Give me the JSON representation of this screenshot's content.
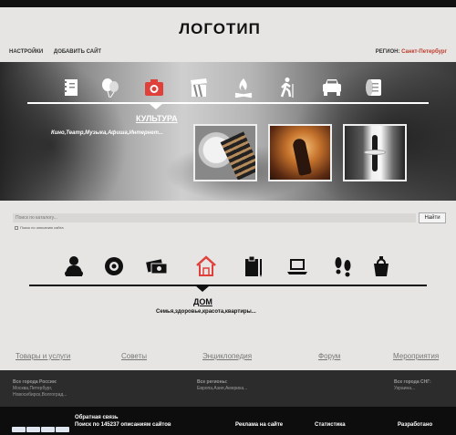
{
  "header": {
    "logo": "ЛОГОТИП",
    "nav": [
      "НАСТРОЙКИ",
      "ДОБАВИТЬ САЙТ"
    ],
    "region_label": "РЕГИОН:",
    "region_value": "Санкт-Петербург"
  },
  "culture_section": {
    "title": "КУЛЬТУРА",
    "subtitle": "Кино,Театр,Музыка,Афиша,Интернет...",
    "icons": [
      "notebook-icon",
      "balloons-icon",
      "camera-icon",
      "cinema-clapper-icon",
      "campfire-icon",
      "hiker-icon",
      "car-icon",
      "scroll-icon"
    ],
    "active_icon_color": "#e0403a"
  },
  "search": {
    "placeholder": "Поиск по каталогу...",
    "button_label": "Найти",
    "checkbox_label": "Поиск по описанию сайта"
  },
  "home_section": {
    "title": "ДОМ",
    "subtitle": "Семья,здоровье,красота,квартиры...",
    "icons": [
      "baby-icon",
      "disc-icon",
      "money-icon",
      "house-icon",
      "clipboard-icon",
      "laptop-icon",
      "footprints-icon",
      "shopping-bag-icon"
    ],
    "active_icon_color": "#e0403a"
  },
  "bottom_links": [
    "Товары и услуги",
    "Советы",
    "Энциклопедия",
    "Форум",
    "Мероприятия"
  ],
  "footer": {
    "col1_title": "Все города России:",
    "col1_text": "Москва,Петербург,",
    "col1_text2": "Новосибирск,Волгоград...",
    "col2_title": "Все регионы:",
    "col2_text": "Европа,Азия,Америка...",
    "col3_title": "Все города СНГ:",
    "col3_text": "Украина...",
    "feedback": "Обратная связь",
    "search_count": "Поиск по 145237 описаниям сайтов",
    "ads": "Реклама на сайте",
    "stats": "Статистика",
    "developed": "Разработано"
  }
}
